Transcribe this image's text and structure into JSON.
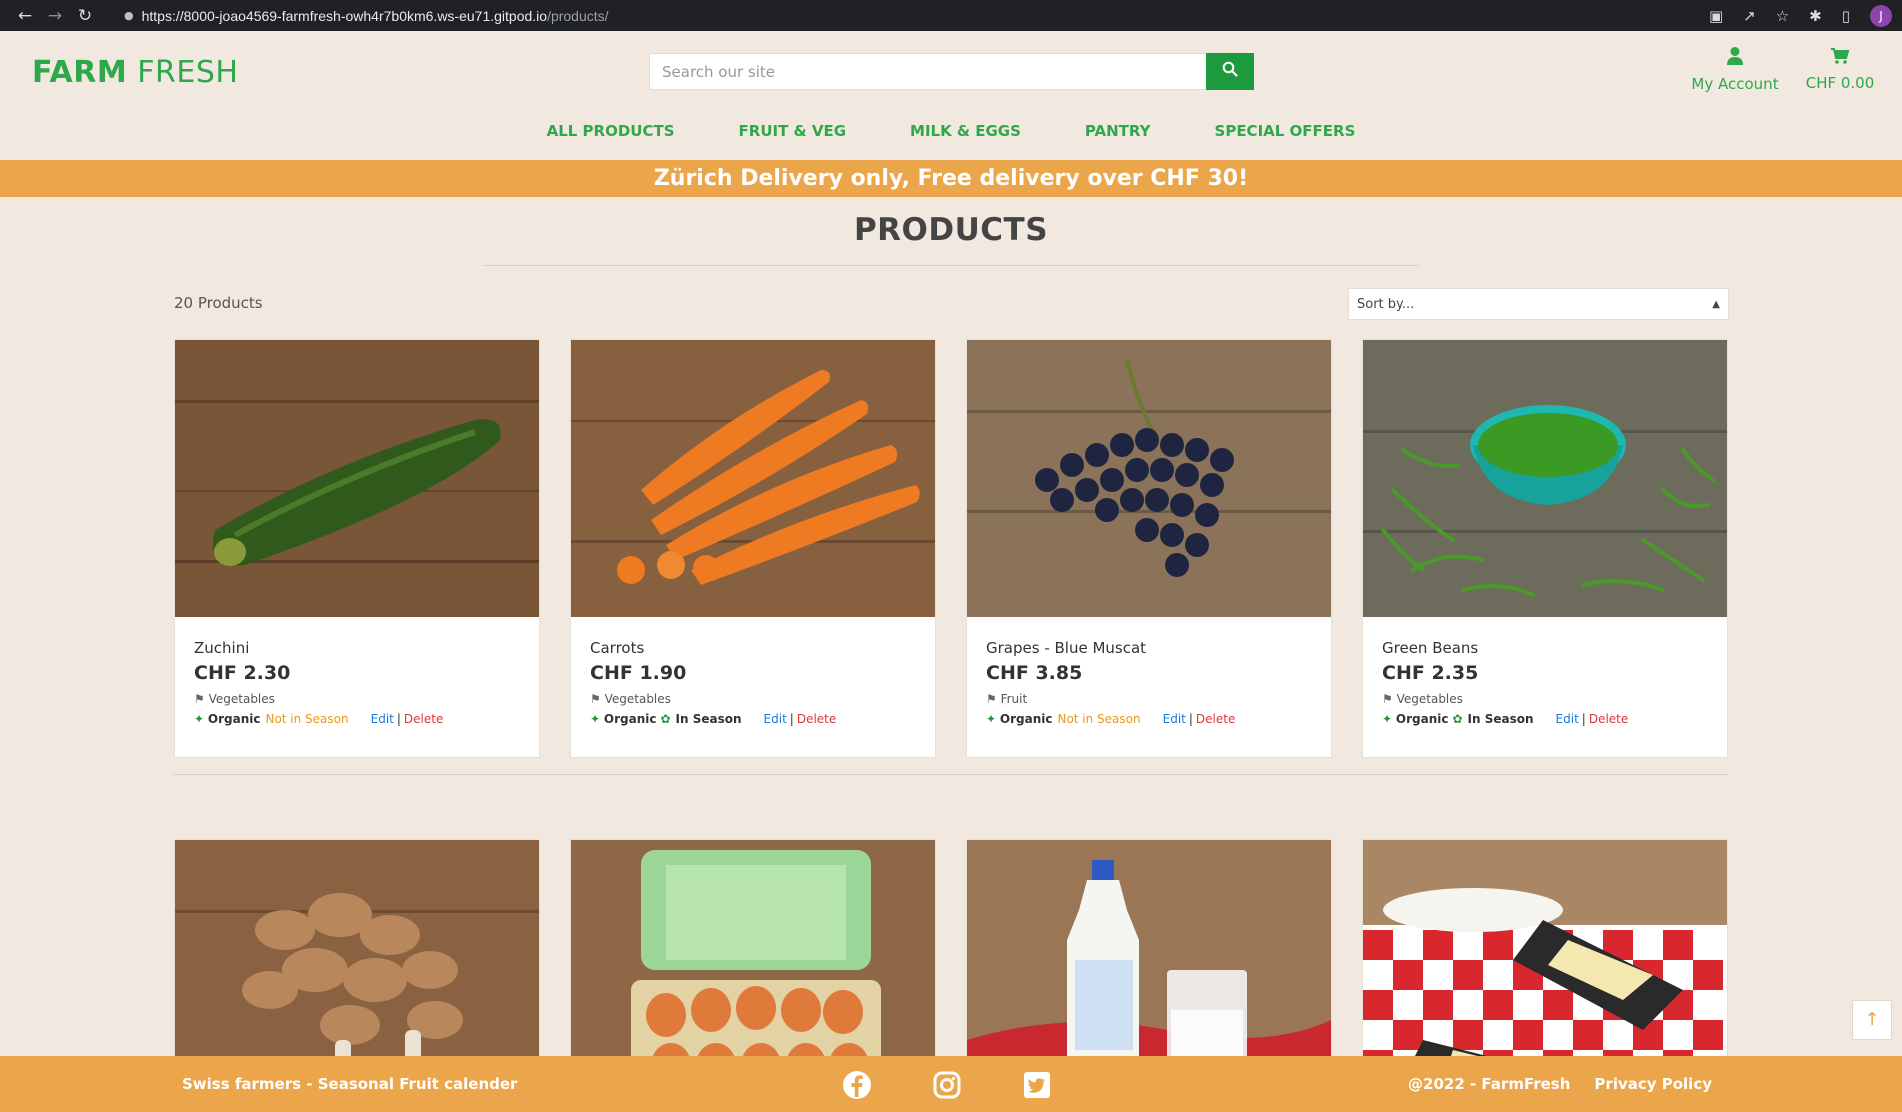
{
  "browser": {
    "url_host": "https://8000-joao4569-farmfresh-owh4r7b0km6.ws-eu71.gitpod.io",
    "url_path": "/products/",
    "profile_initial": "J"
  },
  "header": {
    "logo_part1": "FARM",
    "logo_part2": "FRESH",
    "search_placeholder": "Search our site",
    "account_label": "My Account",
    "cart_total": "CHF 0.00"
  },
  "nav": [
    "ALL PRODUCTS",
    "FRUIT & VEG",
    "MILK & EGGS",
    "PANTRY",
    "SPECIAL OFFERS"
  ],
  "banner": "Zürich Delivery only, Free delivery over CHF 30!",
  "page_title": "PRODUCTS",
  "product_count": "20 Products",
  "sort_label": "Sort by...",
  "products": [
    {
      "name": "Zuchini",
      "price": "CHF 2.30",
      "category": "Vegetables",
      "organic": "Organic",
      "season": "Not in Season",
      "in_season": false
    },
    {
      "name": "Carrots",
      "price": "CHF 1.90",
      "category": "Vegetables",
      "organic": "Organic",
      "season": "In Season",
      "in_season": true
    },
    {
      "name": "Grapes - Blue Muscat",
      "price": "CHF 3.85",
      "category": "Fruit",
      "organic": "Organic",
      "season": "Not in Season",
      "in_season": false
    },
    {
      "name": "Green Beans",
      "price": "CHF 2.35",
      "category": "Vegetables",
      "organic": "Organic",
      "season": "In Season",
      "in_season": true
    }
  ],
  "admin": {
    "edit": "Edit",
    "sep": "|",
    "delete": "Delete"
  },
  "footer": {
    "left": "Swiss farmers - Seasonal Fruit calender",
    "copyright": "@2022 - FarmFresh",
    "privacy": "Privacy Policy"
  },
  "colors": {
    "brand_green": "#2ea84a",
    "accent_orange": "#eba54a",
    "background": "#f1e9df"
  }
}
